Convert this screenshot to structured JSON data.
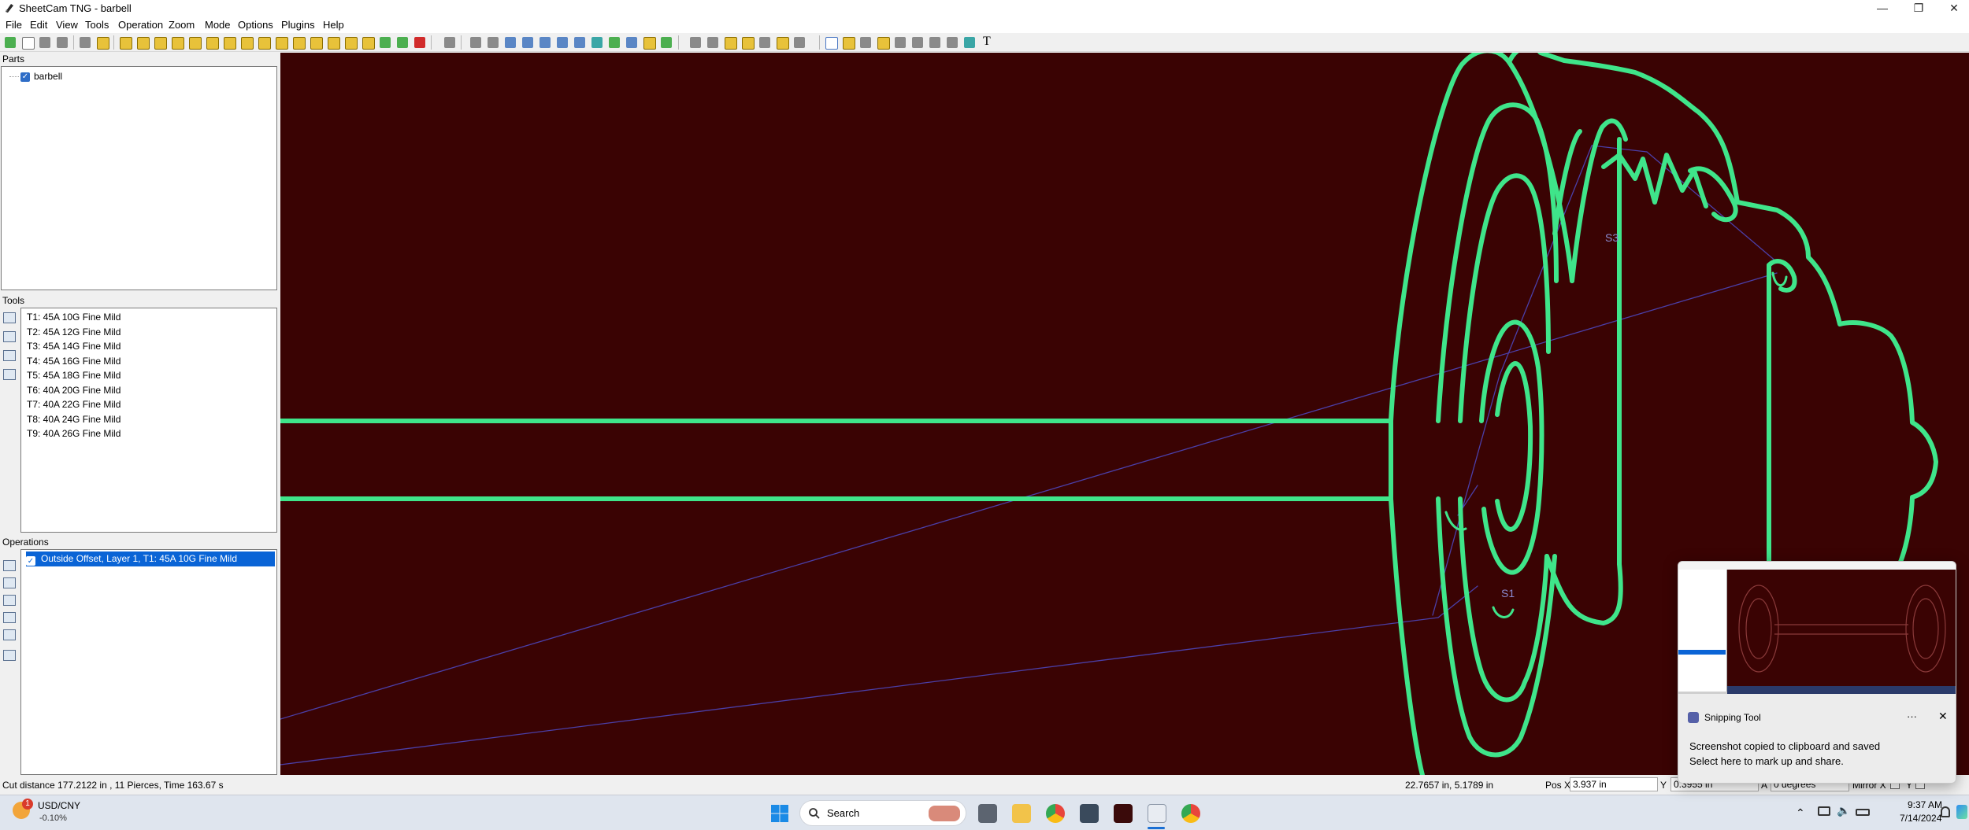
{
  "window": {
    "title": "SheetCam TNG - barbell",
    "controls": [
      "minimize-icon",
      "maximize-icon",
      "close-icon"
    ]
  },
  "menu": [
    "File",
    "Edit",
    "View",
    "Tools",
    "Operation",
    "Zoom",
    "Mode",
    "Options",
    "Plugins",
    "Help"
  ],
  "toolbar": {
    "text_tool_glyph": "T"
  },
  "panels": {
    "parts": {
      "title": "Parts",
      "items": [
        {
          "label": "barbell",
          "checked": true
        }
      ]
    },
    "tools": {
      "title": "Tools",
      "items": [
        "T1: 45A 10G Fine Mild",
        "T2: 45A 12G Fine Mild",
        "T3: 45A 14G Fine Mild",
        "T4: 45A 16G Fine Mild",
        "T5: 45A 18G Fine Mild",
        "T6: 40A 20G Fine Mild",
        "T7: 40A 22G Fine Mild",
        "T8: 40A 24G Fine Mild",
        "T9: 40A 26G Fine Mild"
      ]
    },
    "operations": {
      "title": "Operations",
      "items": [
        {
          "label": "Outside Offset, Layer 1, T1: 45A 10G Fine Mild",
          "checked": true,
          "selected": true
        }
      ]
    }
  },
  "canvas": {
    "background": "#3a0303",
    "part_color": "#3fe58a",
    "rapid_color": "#4b3fa8",
    "labels": {
      "start_1": "S1",
      "start_3": "S3"
    }
  },
  "status": {
    "cut_info": "Cut distance 177.2122 in , 11 Pierces, Time 163.67 s",
    "cursor": "22.7657 in, 5.1789 in",
    "pos_x_label": "Pos X",
    "pos_x_value": "3.937 in",
    "y_label": "Y",
    "y_value": "0.3955 in",
    "angle_label": "A",
    "angle_value": "0 degrees",
    "mirror_x_label": "Mirror X",
    "y_check_label": "Y"
  },
  "taskbar": {
    "currency_pair": "USD/CNY",
    "currency_change": "-0.10%",
    "currency_badge": "1",
    "search_label": "Search",
    "time": "9:37 AM",
    "date": "7/14/2024"
  },
  "toast": {
    "app": "Snipping Tool",
    "more": "···",
    "title": "Screenshot copied to clipboard and saved",
    "body": "Select here to mark up and share."
  }
}
